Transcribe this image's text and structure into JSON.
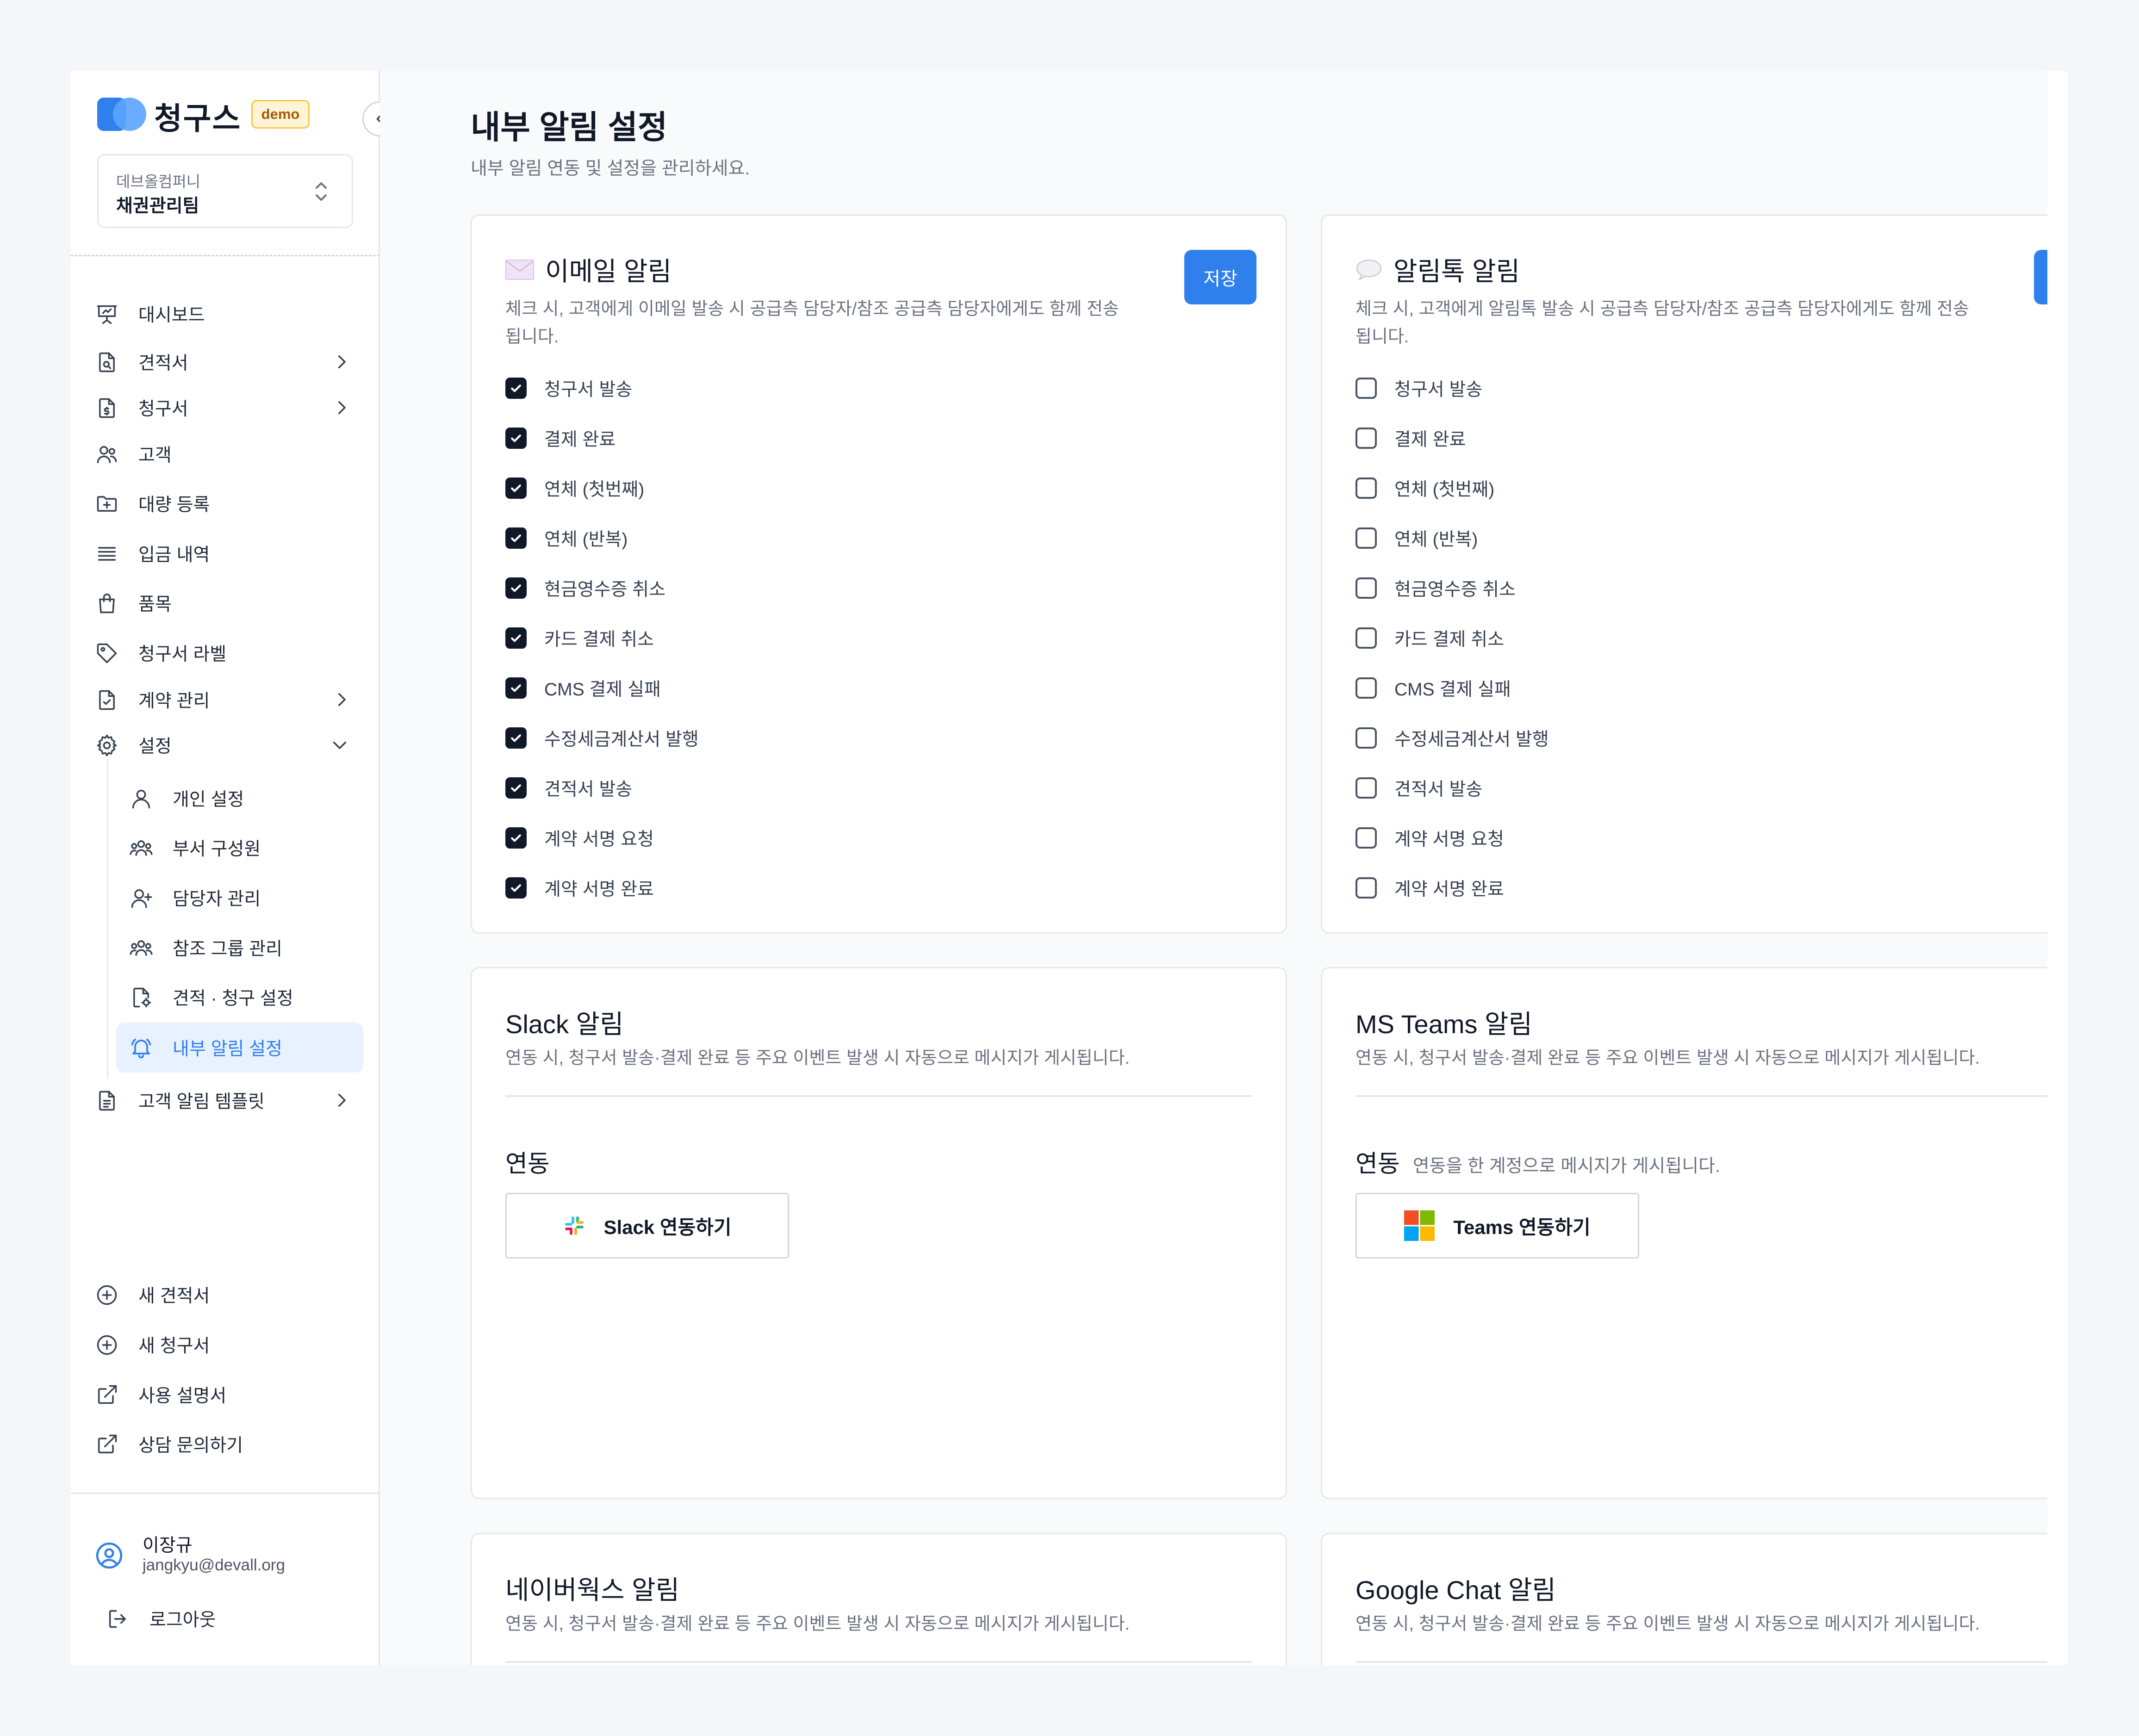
{
  "brand": {
    "name": "청구스",
    "badge": "demo"
  },
  "org": {
    "company": "데브올컴퍼니",
    "team": "채권관리팀"
  },
  "nav": {
    "dashboard": "대시보드",
    "quote": "견적서",
    "invoice": "청구서",
    "customer": "고객",
    "bulk": "대량 등록",
    "deposit": "입금 내역",
    "items": "품목",
    "invoice_label": "청구서 라벨",
    "contract": "계약 관리",
    "settings": "설정",
    "sub": {
      "personal": "개인 설정",
      "members": "부서 구성원",
      "managers": "담당자 관리",
      "ref_group": "참조 그룹 관리",
      "quote_invoice": "견적 · 청구 설정",
      "internal_alert": "내부 알림 설정"
    },
    "customer_template": "고객 알림 템플릿"
  },
  "quick": {
    "new_quote": "새 견적서",
    "new_invoice": "새 청구서",
    "manual": "사용 설명서",
    "consult": "상담 문의하기"
  },
  "user": {
    "name": "이장규",
    "email": "jangkyu@devall.org",
    "logout": "로그아웃"
  },
  "page": {
    "title": "내부 알림 설정",
    "subtitle": "내부 알림 연동 및 설정을 관리하세요."
  },
  "email_card": {
    "title": "이메일 알림",
    "desc_line1": "체크 시, 고객에게 이메일 발송 시 공급측 담당자/참조 공급측 담당자에게도 함께 전송",
    "desc_line2": "됩니다.",
    "save": "저장"
  },
  "talk_card": {
    "title": "알림톡 알림",
    "desc_line1": "체크 시, 고객에게 알림톡 발송 시 공급측 담당자/참조 공급측 담당자에게도 함께 전송",
    "desc_line2": "됩니다."
  },
  "events": [
    "청구서 발송",
    "결제 완료",
    "연체 (첫번째)",
    "연체 (반복)",
    "현금영수증 취소",
    "카드 결제 취소",
    "CMS 결제 실패",
    "수정세금계산서 발행",
    "견적서 발송",
    "계약 서명 요청",
    "계약 서명 완료"
  ],
  "email_checked": [
    true,
    true,
    true,
    true,
    true,
    true,
    true,
    true,
    true,
    true,
    true
  ],
  "talk_checked": [
    false,
    false,
    false,
    false,
    false,
    false,
    false,
    false,
    false,
    false,
    false
  ],
  "integration_desc": "연동 시, 청구서 발송·결제 완료 등 주요 이벤트 발생 시 자동으로 메시지가 게시됩니다.",
  "slack": {
    "title": "Slack 알림",
    "section": "연동",
    "button": "Slack 연동하기"
  },
  "teams": {
    "title": "MS Teams 알림",
    "section": "연동",
    "hint": "연동을 한 계정으로 메시지가 게시됩니다.",
    "button": "Teams 연동하기"
  },
  "naver": {
    "title": "네이버웍스 알림"
  },
  "gchat": {
    "title": "Google Chat 알림"
  },
  "colors": {
    "accent": "#2f80ed",
    "text": "#111827",
    "muted": "#6b7280",
    "border": "#e5e7eb"
  },
  "icons": {
    "email": "envelope-icon",
    "talk": "speech-bubble-icon",
    "slack": "slack-logo-icon",
    "teams": "microsoft-logo-icon"
  }
}
